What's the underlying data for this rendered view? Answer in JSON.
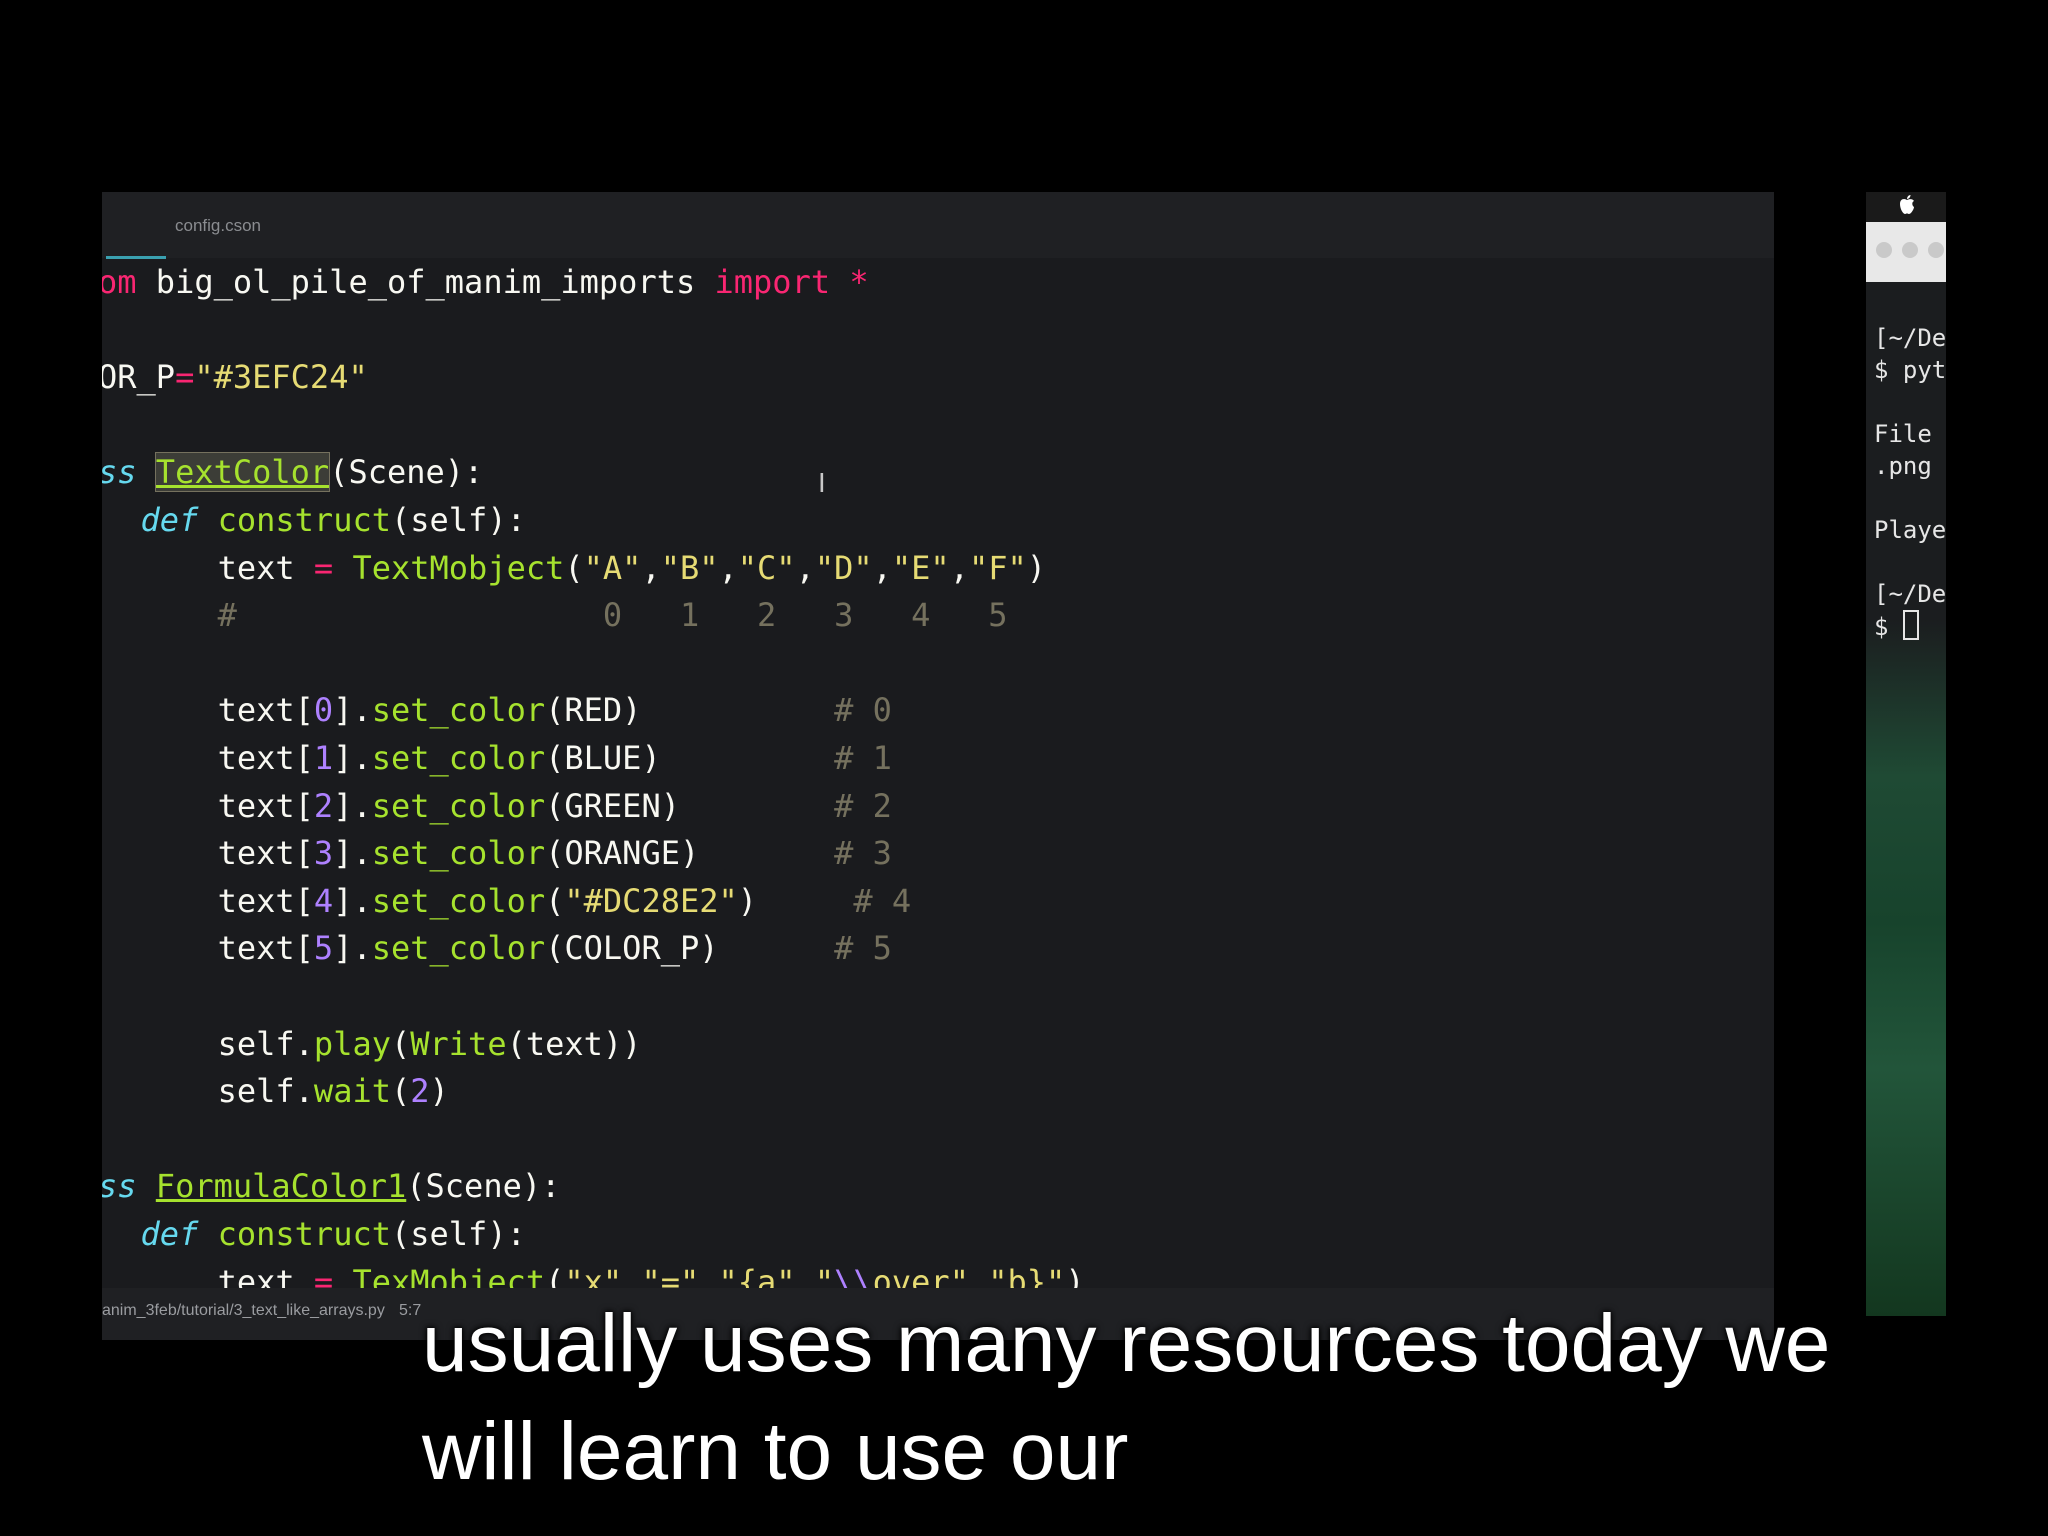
{
  "editor": {
    "tab": {
      "label": "config.cson"
    },
    "lines": [
      {
        "segs": [
          [
            "kw",
            "om"
          ],
          [
            "p",
            " big_ol_pile_of_manim_imports "
          ],
          [
            "kw",
            "import"
          ],
          [
            "p",
            " "
          ],
          [
            "kw",
            "*"
          ]
        ]
      },
      {
        "segs": []
      },
      {
        "segs": [
          [
            "p",
            "OR_P"
          ],
          [
            "kw",
            "="
          ],
          [
            "str",
            "\"#3EFC24\""
          ]
        ]
      },
      {
        "segs": []
      },
      {
        "segs": [
          [
            "kw2",
            "ss"
          ],
          [
            "p",
            " "
          ],
          [
            "clshl",
            "TextColor"
          ],
          [
            "p",
            "(Scene):"
          ]
        ]
      },
      {
        "segs": [
          [
            "p",
            "  "
          ],
          [
            "kw2",
            "def"
          ],
          [
            "p",
            " "
          ],
          [
            "fn",
            "construct"
          ],
          [
            "p",
            "(self):"
          ]
        ]
      },
      {
        "segs": [
          [
            "p",
            "      text "
          ],
          [
            "kw",
            "="
          ],
          [
            "p",
            " "
          ],
          [
            "fn",
            "TextMobject"
          ],
          [
            "p",
            "("
          ],
          [
            "str",
            "\"A\""
          ],
          [
            "p",
            ","
          ],
          [
            "str",
            "\"B\""
          ],
          [
            "p",
            ","
          ],
          [
            "str",
            "\"C\""
          ],
          [
            "p",
            ","
          ],
          [
            "str",
            "\"D\""
          ],
          [
            "p",
            ","
          ],
          [
            "str",
            "\"E\""
          ],
          [
            "p",
            ","
          ],
          [
            "str",
            "\"F\""
          ],
          [
            "p",
            ")"
          ]
        ]
      },
      {
        "segs": [
          [
            "cmt",
            "      #                   0   1   2   3   4   5"
          ]
        ]
      },
      {
        "segs": []
      },
      {
        "segs": [
          [
            "p",
            "      text["
          ],
          [
            "num",
            "0"
          ],
          [
            "p",
            "]."
          ],
          [
            "fn",
            "set_color"
          ],
          [
            "p",
            "(RED)          "
          ],
          [
            "cmt",
            "# 0"
          ]
        ]
      },
      {
        "segs": [
          [
            "p",
            "      text["
          ],
          [
            "num",
            "1"
          ],
          [
            "p",
            "]."
          ],
          [
            "fn",
            "set_color"
          ],
          [
            "p",
            "(BLUE)         "
          ],
          [
            "cmt",
            "# 1"
          ]
        ]
      },
      {
        "segs": [
          [
            "p",
            "      text["
          ],
          [
            "num",
            "2"
          ],
          [
            "p",
            "]."
          ],
          [
            "fn",
            "set_color"
          ],
          [
            "p",
            "(GREEN)        "
          ],
          [
            "cmt",
            "# 2"
          ]
        ]
      },
      {
        "segs": [
          [
            "p",
            "      text["
          ],
          [
            "num",
            "3"
          ],
          [
            "p",
            "]."
          ],
          [
            "fn",
            "set_color"
          ],
          [
            "p",
            "(ORANGE)       "
          ],
          [
            "cmt",
            "# 3"
          ]
        ]
      },
      {
        "segs": [
          [
            "p",
            "      text["
          ],
          [
            "num",
            "4"
          ],
          [
            "p",
            "]."
          ],
          [
            "fn",
            "set_color"
          ],
          [
            "p",
            "("
          ],
          [
            "str",
            "\"#DC28E2\""
          ],
          [
            "p",
            ")     "
          ],
          [
            "cmt",
            "# 4"
          ]
        ]
      },
      {
        "segs": [
          [
            "p",
            "      text["
          ],
          [
            "num",
            "5"
          ],
          [
            "p",
            "]."
          ],
          [
            "fn",
            "set_color"
          ],
          [
            "p",
            "(COLOR_P)      "
          ],
          [
            "cmt",
            "# 5"
          ]
        ]
      },
      {
        "segs": []
      },
      {
        "segs": [
          [
            "p",
            "      self."
          ],
          [
            "fn",
            "play"
          ],
          [
            "p",
            "("
          ],
          [
            "fn",
            "Write"
          ],
          [
            "p",
            "(text))"
          ]
        ]
      },
      {
        "segs": [
          [
            "p",
            "      self."
          ],
          [
            "fn",
            "wait"
          ],
          [
            "p",
            "("
          ],
          [
            "num",
            "2"
          ],
          [
            "p",
            ")"
          ]
        ]
      },
      {
        "segs": []
      },
      {
        "segs": [
          [
            "kw2",
            "ss"
          ],
          [
            "p",
            " "
          ],
          [
            "cls",
            "FormulaColor1"
          ],
          [
            "p",
            "(Scene):"
          ]
        ]
      },
      {
        "segs": [
          [
            "p",
            "  "
          ],
          [
            "kw2",
            "def"
          ],
          [
            "p",
            " "
          ],
          [
            "fn",
            "construct"
          ],
          [
            "p",
            "(self):"
          ]
        ]
      },
      {
        "segs": [
          [
            "p",
            "      text "
          ],
          [
            "kw",
            "="
          ],
          [
            "p",
            " "
          ],
          [
            "fn",
            "TexMobject"
          ],
          [
            "p",
            "("
          ],
          [
            "str",
            "\"x\""
          ],
          [
            "p",
            ","
          ],
          [
            "str",
            "\"=\""
          ],
          [
            "p",
            ","
          ],
          [
            "str",
            "\"{a\""
          ],
          [
            "p",
            ","
          ],
          [
            "str",
            "\""
          ],
          [
            "num",
            "\\\\"
          ],
          [
            "str",
            "over\""
          ],
          [
            "p",
            ","
          ],
          [
            "str",
            "\"b}\""
          ],
          [
            "p",
            ")"
          ]
        ]
      }
    ],
    "status": {
      "path": "anim_3feb/tutorial/3_text_like_arrays.py",
      "cursor_pos": "5:7"
    }
  },
  "terminal": {
    "text": "[~/De\n$ pyt\n\nFile \n.png\n\nPlaye\n\n[~/De\n$ "
  },
  "subtitles": {
    "line1": "usually uses many resources today we",
    "line2": "will learn to use our"
  },
  "colors": {
    "editor_bg": "#1a1b1e",
    "keyword": "#f92672",
    "function": "#a6e22e",
    "string": "#e6db74",
    "number": "#ae81ff",
    "comment": "#75715e",
    "storage": "#66d9ef"
  }
}
